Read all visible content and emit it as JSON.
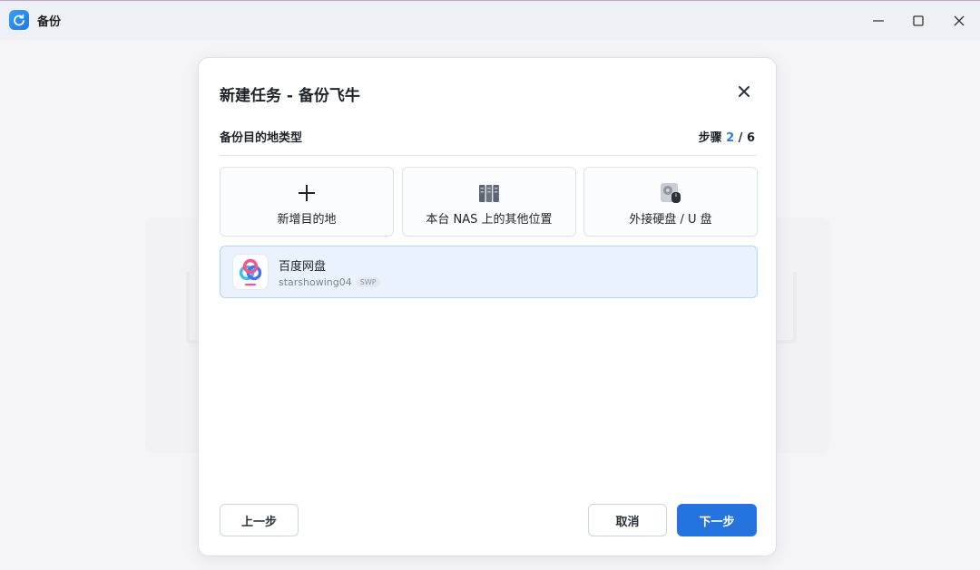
{
  "window": {
    "title": "备份",
    "icons": {
      "app": "refresh-icon",
      "minimize": "minimize-icon",
      "maximize": "maximize-icon",
      "close": "close-icon"
    }
  },
  "dialog": {
    "title": "新建任务 - 备份飞牛",
    "section_label": "备份目的地类型",
    "step": {
      "prefix": "步骤 ",
      "current": "2",
      "separator": " / ",
      "total": "6"
    },
    "tiles": [
      {
        "label": "新增目的地",
        "icon": "plus-icon"
      },
      {
        "label": "本台 NAS 上的其他位置",
        "icon": "server-rack-icon"
      },
      {
        "label": "外接硬盘 / U 盘",
        "icon": "external-drive-icon"
      }
    ],
    "destination": {
      "name": "百度网盘",
      "account": "starshowing04",
      "badge": "SWP",
      "icon": "baidu-netdisk-icon"
    },
    "buttons": {
      "prev": "上一步",
      "cancel": "取消",
      "next": "下一步"
    }
  },
  "colors": {
    "accent": "#2473de",
    "selected_bg": "#eaf3fd",
    "selected_border": "#b9d3f3"
  }
}
